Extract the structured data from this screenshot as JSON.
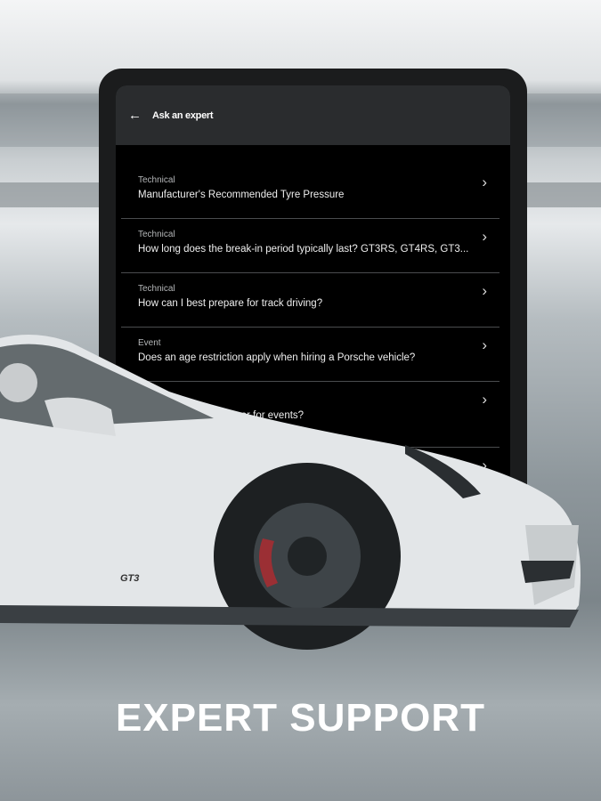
{
  "header": {
    "title": "Ask an expert"
  },
  "questions": [
    {
      "category": "Technical",
      "question": "Manufacturer's Recommended Tyre Pressure"
    },
    {
      "category": "Technical",
      "question": "How long does the break-in period typically last? GT3RS, GT4RS, GT3..."
    },
    {
      "category": "Technical",
      "question": "How can I best prepare for track driving?"
    },
    {
      "category": "Event",
      "question": "Does an age restriction apply when hiring a Porsche vehicle?"
    },
    {
      "category": "",
      "question": "ser for events?"
    },
    {
      "category": "",
      "question": ""
    }
  ],
  "headline": "EXPERT SUPPORT",
  "car_badge": "GT3"
}
